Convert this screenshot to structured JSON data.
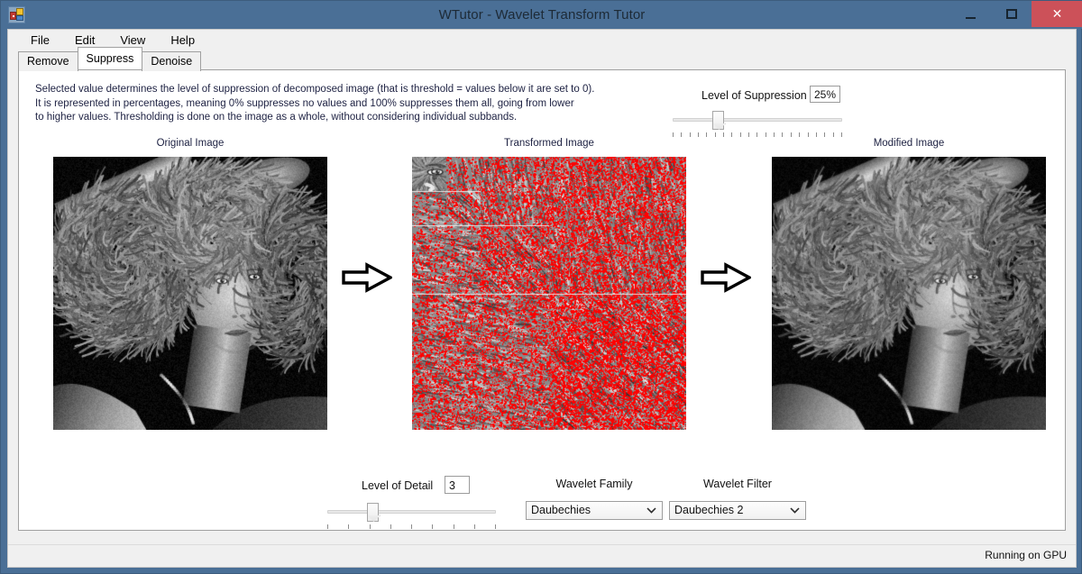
{
  "window": {
    "title": "WTutor - Wavelet Transform Tutor",
    "icon": "app-form-icon",
    "minimize_label": "–",
    "maximize_label": "□",
    "close_label": "✕"
  },
  "menu": {
    "items": [
      {
        "label": "File"
      },
      {
        "label": "Edit"
      },
      {
        "label": "View"
      },
      {
        "label": "Help"
      }
    ]
  },
  "tabs": [
    {
      "label": "Remove",
      "active": false
    },
    {
      "label": "Suppress",
      "active": true
    },
    {
      "label": "Denoise",
      "active": false
    }
  ],
  "description": {
    "line1": "Selected value determines the level of suppression of decomposed image (that is threshold = values below it are set to 0).",
    "line2": "It is represented in percentages, meaning 0% suppresses no values and 100% suppresses them all, going from lower",
    "line3": "to higher values. Thresholding is done on the image as a whole, without considering individual subbands."
  },
  "suppression": {
    "label": "Level of Suppression",
    "value": "25%",
    "slider": {
      "min": 0,
      "max": 100,
      "value": 25,
      "ticks": 21
    }
  },
  "images": [
    {
      "caption": "Original Image",
      "kind": "original"
    },
    {
      "caption": "Transformed Image",
      "kind": "wavelet"
    },
    {
      "caption": "Modified Image",
      "kind": "modified"
    }
  ],
  "arrows": [
    {
      "name": "arrow-original-to-transformed",
      "glyph": "⇨"
    },
    {
      "name": "arrow-transformed-to-modified",
      "glyph": "⇨"
    }
  ],
  "detail": {
    "label": "Level of Detail",
    "value": "3",
    "slider": {
      "min": 1,
      "max": 9,
      "value": 3,
      "ticks": 9
    }
  },
  "wavelet_family": {
    "label": "Wavelet Family",
    "value": "Daubechies",
    "chevron": "⌄"
  },
  "wavelet_filter": {
    "label": "Wavelet Filter",
    "value": "Daubechies 2",
    "chevron": "⌄"
  },
  "status": {
    "text": "Running on GPU"
  },
  "colors": {
    "titlebar": "#4a6f96",
    "close_button": "#cc5159",
    "suppressed_overlay": "#ff0000",
    "panel_background": "#ffffff",
    "client_background": "#f0f0f0"
  }
}
